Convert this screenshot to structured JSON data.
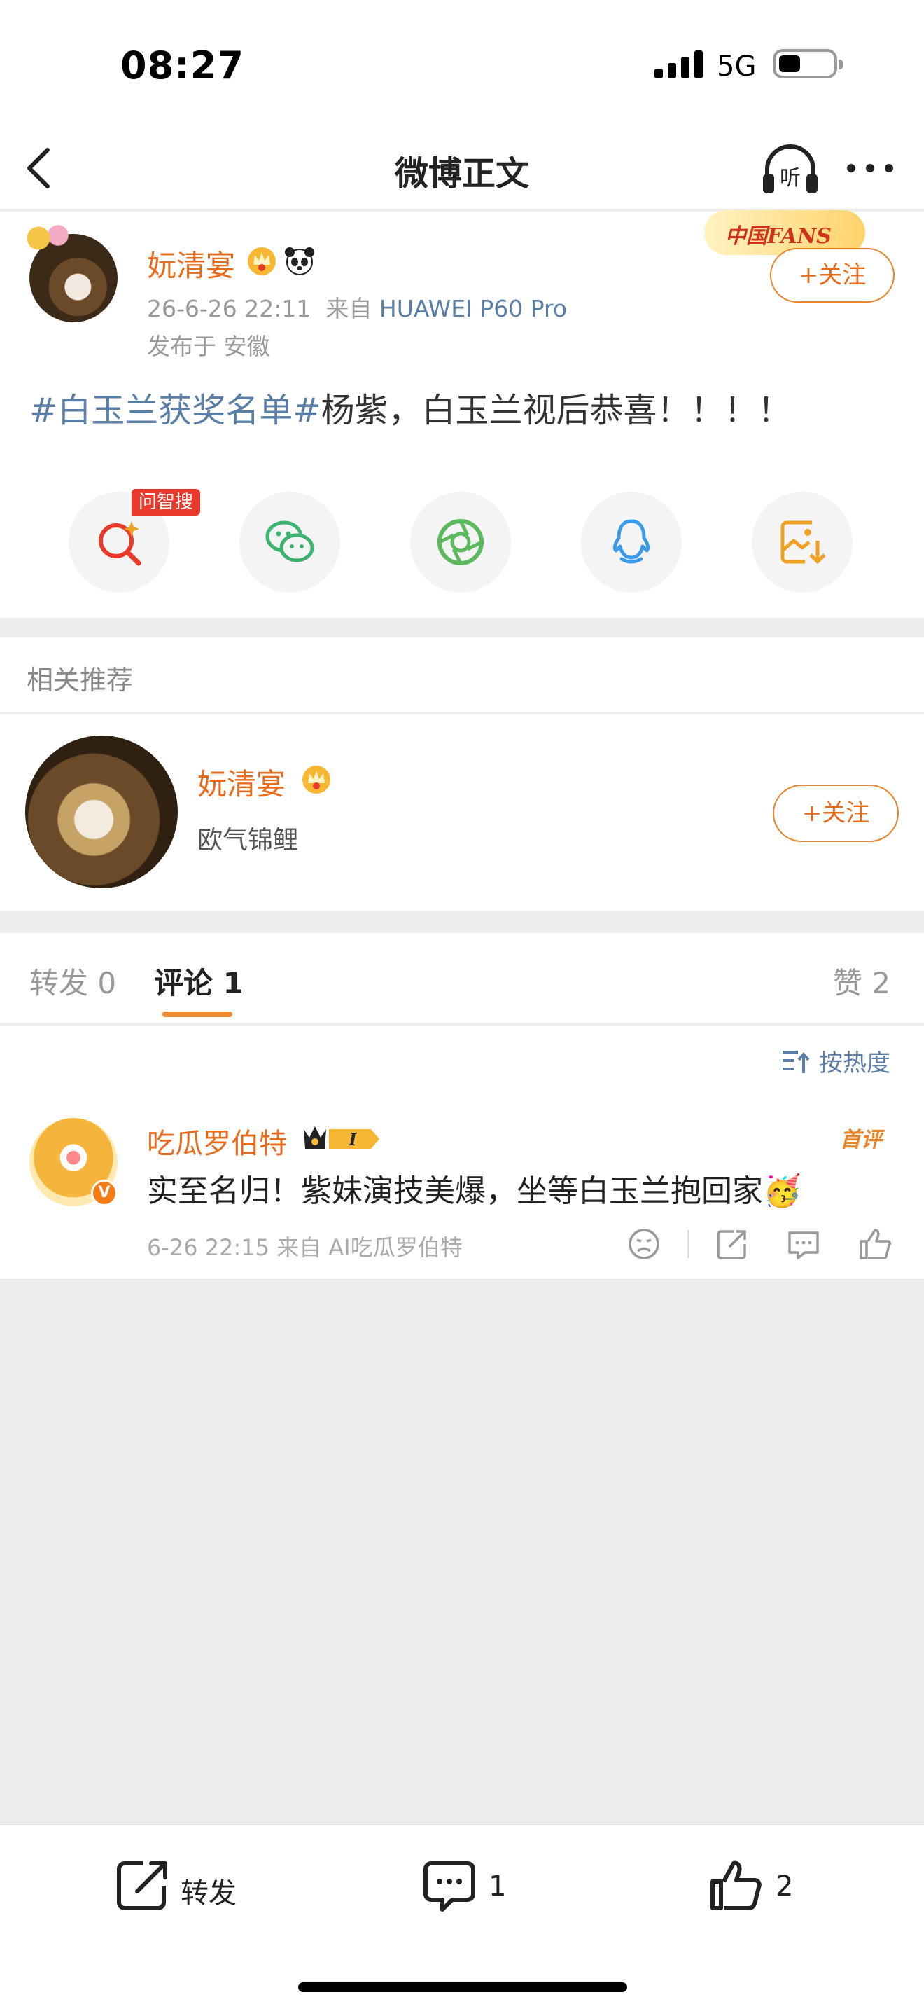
{
  "status_bar": {
    "time": "08:27",
    "network": "5G"
  },
  "nav": {
    "title": "微博正文"
  },
  "post": {
    "username": "妧清宴",
    "date": "26-6-26 22:11",
    "source_prefix": "来自",
    "device": "HUAWEI P60 Pro",
    "location": "发布于 安徽",
    "fans_badge": "中国FANS",
    "follow_label": "+关注",
    "topic": "#白玉兰获奖名单#",
    "text": "杨紫，白玉兰视后恭喜！！！！",
    "ai_tag": "问智搜"
  },
  "share": [
    "search-ai-icon",
    "wechat-icon",
    "moments-icon",
    "qq-icon",
    "save-image-icon"
  ],
  "related": {
    "header": "相关推荐",
    "name": "妧清宴",
    "desc": "欧气锦鲤",
    "follow_label": "+关注"
  },
  "tabs": {
    "repost": "转发 0",
    "comment": "评论 1",
    "likes": "赞 2"
  },
  "sort": {
    "label": "按热度"
  },
  "comment": {
    "user": "吃瓜罗伯特",
    "badge_level": "I",
    "first_tag": "首评",
    "text": "实至名归！紫妹演技美爆，坐等白玉兰抱回家🥳",
    "meta": "6-26 22:15  来自 AI吃瓜罗伯特"
  },
  "toolbar": {
    "repost": "转发",
    "comment": "1",
    "like": "2"
  },
  "colors": {
    "accent": "#e86b1c",
    "link": "#5b7ea6",
    "badge_red": "#e8392b"
  }
}
